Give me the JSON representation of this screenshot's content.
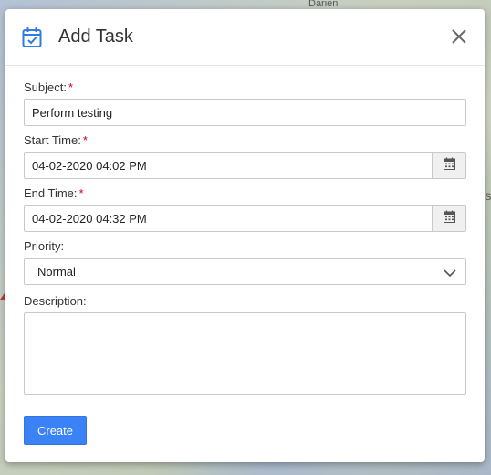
{
  "background": {
    "map_label_top": "Darien",
    "map_label_side": "Sr"
  },
  "dialog": {
    "title": "Add Task",
    "header_icon": "calendar-check-icon",
    "close_icon": "close-icon"
  },
  "form": {
    "subject": {
      "label": "Subject:",
      "required": "*",
      "value": "Perform testing"
    },
    "start_time": {
      "label": "Start Time:",
      "required": "*",
      "value": "04-02-2020 04:02 PM",
      "icon": "calendar-icon"
    },
    "end_time": {
      "label": "End Time:",
      "required": "*",
      "value": "04-02-2020 04:32 PM",
      "icon": "calendar-icon"
    },
    "priority": {
      "label": "Priority:",
      "selected": "Normal",
      "icon": "chevron-down-icon"
    },
    "description": {
      "label": "Description:",
      "value": ""
    },
    "create_label": "Create"
  },
  "colors": {
    "accent": "#3b82f6",
    "required": "#d0021b",
    "icon_blue": "#2f7be0"
  }
}
